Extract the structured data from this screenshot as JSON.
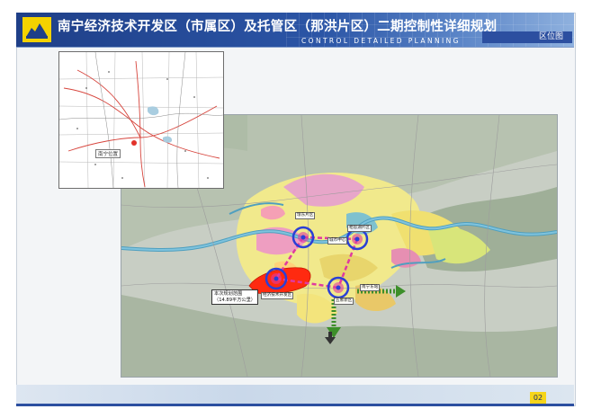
{
  "header": {
    "title": "南宁经济技术开发区（市属区）及托管区（那洪片区）二期控制性详细规划",
    "subtitle": "CONTROL DETAILED PLANNING",
    "section_tag": "区位图"
  },
  "inset": {
    "label": "南宁位置"
  },
  "map_labels": {
    "site": "本次规划范围\n（14.89平方公里）",
    "node_a": "琅东片区",
    "node_b": "相思湖片区",
    "node_c": "五象新区",
    "node_d": "城市中心",
    "node_e": "经济技术开发区",
    "node_f": "南宁东站"
  },
  "footer": {
    "page_number": "02"
  },
  "colors": {
    "header_blue": "#2b55a6",
    "accent_yellow": "#f6d51a",
    "ring_blue": "#2a3fd6",
    "connector_magenta": "#e03aa0",
    "site_red": "#ff2a10",
    "arrow_green": "#3d8f2a"
  },
  "icons": [
    "logo-icon"
  ]
}
